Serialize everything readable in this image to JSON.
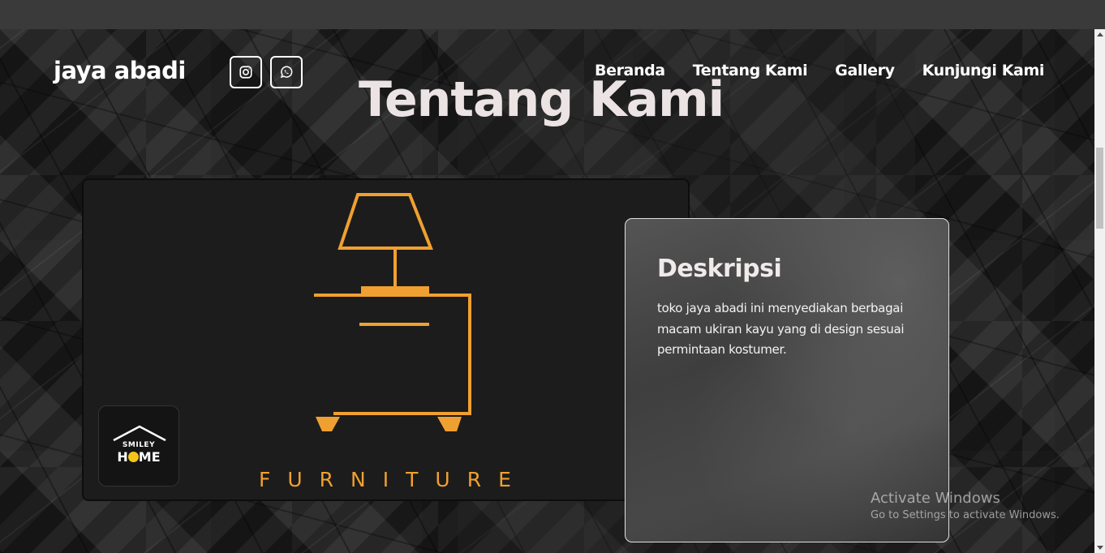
{
  "header": {
    "brand": "jaya abadi",
    "nav": [
      "Beranda",
      "Tentang Kami",
      "Gallery",
      "Kunjungi Kami"
    ]
  },
  "social": [
    {
      "icon": "instagram-icon"
    },
    {
      "icon": "whatsapp-icon"
    }
  ],
  "main": {
    "title": "Tentang Kami"
  },
  "image_card": {
    "furniture_text": "FURNITURE",
    "logo_top": "SMILEY",
    "logo_bottom_h": "H",
    "logo_bottom_rest": "ME"
  },
  "description": {
    "title": "Deskripsi",
    "text": "toko jaya abadi ini menyediakan berbagai macam ukiran kayu yang di design sesuai permintaan kostumer."
  },
  "watermark": {
    "line1": "Activate Windows",
    "line2": "Go to Settings to activate Windows."
  },
  "colors": {
    "accent": "#f0a030",
    "title": "#ece4e4",
    "smiley_yellow": "#f5c518"
  }
}
